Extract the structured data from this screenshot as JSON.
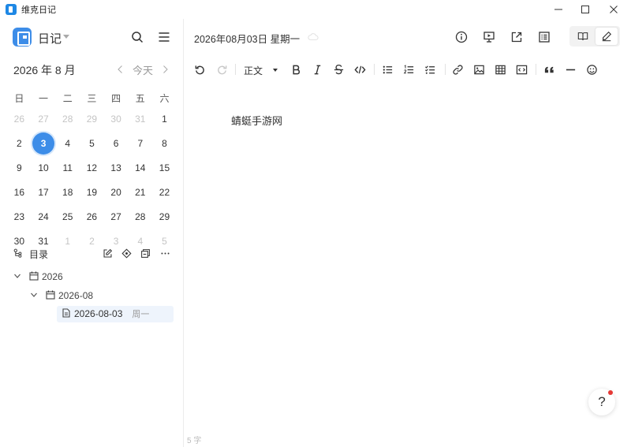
{
  "window": {
    "title": "维克日记"
  },
  "sidebar": {
    "title": "日记",
    "calendar": {
      "month_title": "2026 年 8 月",
      "today_label": "今天",
      "weekdays": [
        "日",
        "一",
        "二",
        "三",
        "四",
        "五",
        "六"
      ],
      "days": [
        {
          "d": "26",
          "other": true
        },
        {
          "d": "27",
          "other": true
        },
        {
          "d": "28",
          "other": true
        },
        {
          "d": "29",
          "other": true
        },
        {
          "d": "30",
          "other": true
        },
        {
          "d": "31",
          "other": true
        },
        {
          "d": "1",
          "other": false
        },
        {
          "d": "2",
          "other": false
        },
        {
          "d": "3",
          "other": false,
          "selected": true
        },
        {
          "d": "4",
          "other": false
        },
        {
          "d": "5",
          "other": false
        },
        {
          "d": "6",
          "other": false
        },
        {
          "d": "7",
          "other": false
        },
        {
          "d": "8",
          "other": false
        },
        {
          "d": "9",
          "other": false
        },
        {
          "d": "10",
          "other": false
        },
        {
          "d": "11",
          "other": false
        },
        {
          "d": "12",
          "other": false
        },
        {
          "d": "13",
          "other": false
        },
        {
          "d": "14",
          "other": false
        },
        {
          "d": "15",
          "other": false
        },
        {
          "d": "16",
          "other": false
        },
        {
          "d": "17",
          "other": false
        },
        {
          "d": "18",
          "other": false
        },
        {
          "d": "19",
          "other": false
        },
        {
          "d": "20",
          "other": false
        },
        {
          "d": "21",
          "other": false
        },
        {
          "d": "22",
          "other": false
        },
        {
          "d": "23",
          "other": false
        },
        {
          "d": "24",
          "other": false
        },
        {
          "d": "25",
          "other": false
        },
        {
          "d": "26",
          "other": false
        },
        {
          "d": "27",
          "other": false
        },
        {
          "d": "28",
          "other": false
        },
        {
          "d": "29",
          "other": false
        },
        {
          "d": "30",
          "other": false
        },
        {
          "d": "31",
          "other": false
        },
        {
          "d": "1",
          "other": true
        },
        {
          "d": "2",
          "other": true
        },
        {
          "d": "3",
          "other": true
        },
        {
          "d": "4",
          "other": true
        },
        {
          "d": "5",
          "other": true
        }
      ]
    },
    "toc": {
      "label": "目录",
      "year": "2026",
      "month": "2026-08",
      "entry_date": "2026-08-03",
      "entry_week": "周一"
    }
  },
  "main": {
    "date_title": "2026年08月03日 星期一",
    "toolbar": {
      "paragraph_label": "正文"
    },
    "content": "蜻蜓手游网",
    "word_count": "5 字"
  },
  "help": {
    "label": "?"
  },
  "colors": {
    "accent": "#3d8de8",
    "notification": "#e53935"
  }
}
